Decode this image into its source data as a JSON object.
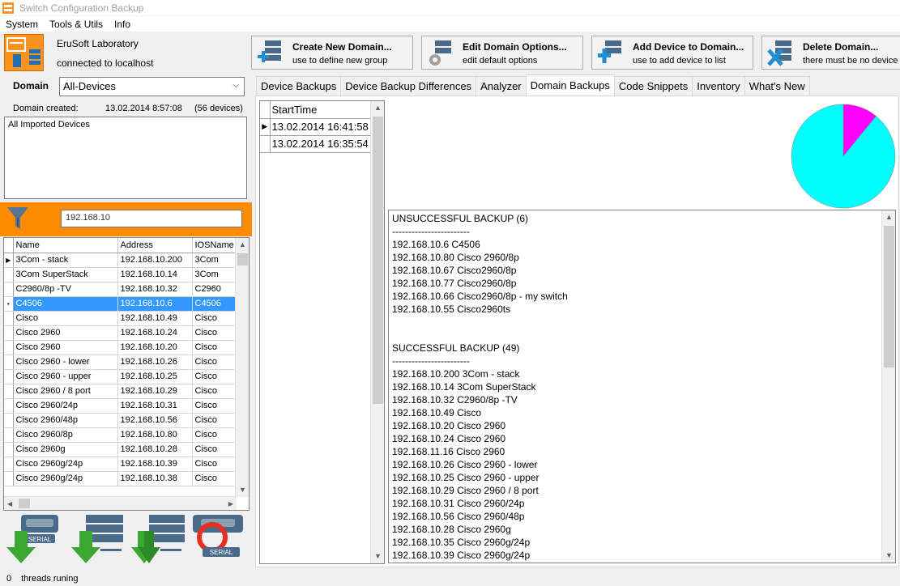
{
  "window": {
    "title": "Switch Configuration Backup"
  },
  "menu": [
    "System",
    "Tools & Utils",
    "Info"
  ],
  "header": {
    "company": "EruSoft Laboratory",
    "connection": "connected to localhost"
  },
  "toolbar": [
    {
      "title": "Create New Domain...",
      "sub": "use to define new group",
      "icon": "add-server-icon"
    },
    {
      "title": "Edit Domain Options...",
      "sub": "edit default options",
      "icon": "gear-icon"
    },
    {
      "title": "Add Device to Domain...",
      "sub": "use to add device to list",
      "icon": "add-device-icon"
    },
    {
      "title": "Delete Domain...",
      "sub": "there must be no device",
      "icon": "delete-icon"
    }
  ],
  "domain": {
    "label": "Domain",
    "selected": "All-Devices",
    "created_label": "Domain created:",
    "created_date": "13.02.2014 8:57:08",
    "device_count": "(56 devices)",
    "description": "All Imported Devices"
  },
  "filter": {
    "value": "192.168.10"
  },
  "device_grid": {
    "columns": [
      "Name",
      "Address",
      "IOSName"
    ],
    "rows": [
      [
        "3Com - stack",
        "192.168.10.200",
        "3Com"
      ],
      [
        "3Com SuperStack",
        "192.168.10.14",
        "3Com"
      ],
      [
        "C2960/8p -TV",
        "192.168.10.32",
        "C2960"
      ],
      [
        "C4506",
        "192.168.10.6",
        "C4506"
      ],
      [
        "Cisco",
        "192.168.10.49",
        "Cisco"
      ],
      [
        "Cisco 2960",
        "192.168.10.24",
        "Cisco"
      ],
      [
        "Cisco 2960",
        "192.168.10.20",
        "Cisco"
      ],
      [
        "Cisco 2960 - lower",
        "192.168.10.26",
        "Cisco"
      ],
      [
        "Cisco 2960 - upper",
        "192.168.10.25",
        "Cisco"
      ],
      [
        "Cisco 2960 / 8 port",
        "192.168.10.29",
        "Cisco"
      ],
      [
        "Cisco 2960/24p",
        "192.168.10.31",
        "Cisco"
      ],
      [
        "Cisco 2960/48p",
        "192.168.10.56",
        "Cisco"
      ],
      [
        "Cisco 2960/8p",
        "192.168.10.80",
        "Cisco"
      ],
      [
        "Cisco 2960g",
        "192.168.10.28",
        "Cisco"
      ],
      [
        "Cisco 2960g/24p",
        "192.168.10.39",
        "Cisco"
      ],
      [
        "Cisco 2960g/24p",
        "192.168.10.38",
        "Cisco"
      ]
    ],
    "selected_index": 3,
    "current_index": 0
  },
  "action_buttons": [
    {
      "name": "backup-serial-button",
      "icon": "serial-download-icon",
      "label": "SERIAL"
    },
    {
      "name": "backup-selected-button",
      "icon": "server-download-icon",
      "label": ""
    },
    {
      "name": "backup-all-button",
      "icon": "servers-download-icon",
      "label": ""
    },
    {
      "name": "restore-serial-button",
      "icon": "serial-refresh-icon",
      "label": "SERIAL"
    }
  ],
  "tabs": [
    {
      "label": "Device Backups",
      "active": false
    },
    {
      "label": "Device Backup Differences",
      "active": false
    },
    {
      "label": "Analyzer",
      "active": false
    },
    {
      "label": "Domain Backups",
      "active": true
    },
    {
      "label": "Code Snippets",
      "active": false
    },
    {
      "label": "Inventory",
      "active": false
    },
    {
      "label": "What's New",
      "active": false
    }
  ],
  "runs": {
    "header": "StartTime",
    "rows": [
      "13.02.2014 16:41:58",
      "13.02.2014 16:35:54"
    ]
  },
  "pie": {
    "slices": [
      {
        "label": "UNSUCCESSFUL",
        "value": 6,
        "color": "#ff00ff"
      },
      {
        "label": "SUCCESSFUL",
        "value": 49,
        "color": "#00ffff"
      }
    ]
  },
  "report": [
    "UNSUCCESSFUL BACKUP (6)",
    "------------------------",
    "192.168.10.6 C4506",
    "192.168.10.80 Cisco 2960/8p",
    "192.168.10.67 Cisco2960/8p",
    "192.168.10.77 Cisco2960/8p",
    "192.168.10.66 Cisco2960/8p - my switch",
    "192.168.10.55 Cisco2960ts",
    "",
    "",
    "SUCCESSFUL BACKUP (49)",
    "------------------------",
    "192.168.10.200 3Com - stack",
    "192.168.10.14 3Com SuperStack",
    "192.168.10.32 C2960/8p -TV",
    "192.168.10.49 Cisco",
    "192.168.10.20 Cisco 2960",
    "192.168.10.24 Cisco 2960",
    "192.168.11.16 Cisco 2960",
    "192.168.10.26 Cisco 2960 - lower",
    "192.168.10.25 Cisco 2960 - upper",
    "192.168.10.29 Cisco 2960 / 8 port",
    "192.168.10.31 Cisco 2960/24p",
    "192.168.10.56 Cisco 2960/48p",
    "192.168.10.28 Cisco 2960g",
    "192.168.10.35 Cisco 2960g/24p",
    "192.168.10.39 Cisco 2960g/24p"
  ],
  "status": {
    "threads": "0",
    "text": "threads runing"
  }
}
